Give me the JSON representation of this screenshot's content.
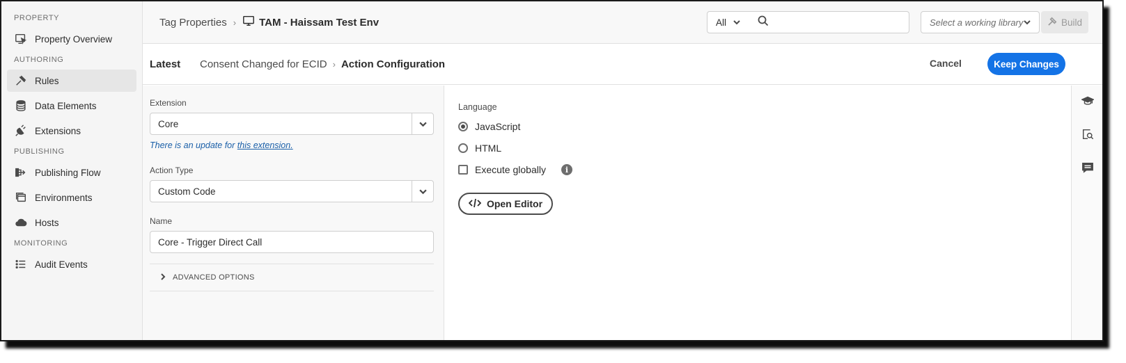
{
  "sidebar": {
    "sections": [
      {
        "title": "PROPERTY",
        "items": [
          {
            "label": "Property Overview",
            "icon": "property-overview-icon"
          }
        ]
      },
      {
        "title": "AUTHORING",
        "items": [
          {
            "label": "Rules",
            "icon": "rules-icon"
          },
          {
            "label": "Data Elements",
            "icon": "data-elements-icon"
          },
          {
            "label": "Extensions",
            "icon": "extensions-icon"
          }
        ]
      },
      {
        "title": "PUBLISHING",
        "items": [
          {
            "label": "Publishing Flow",
            "icon": "publishing-flow-icon"
          },
          {
            "label": "Environments",
            "icon": "environments-icon"
          },
          {
            "label": "Hosts",
            "icon": "hosts-icon"
          }
        ]
      },
      {
        "title": "MONITORING",
        "items": [
          {
            "label": "Audit Events",
            "icon": "audit-events-icon"
          }
        ]
      }
    ],
    "active": "Rules"
  },
  "topbar": {
    "breadcrumb_root": "Tag Properties",
    "property_name": "TAM - Haissam Test Env",
    "filter_value": "All",
    "search_placeholder": "",
    "library_placeholder": "Select a working library",
    "build_label": "Build"
  },
  "subheader": {
    "latest": "Latest",
    "parent": "Consent Changed for ECID",
    "current": "Action Configuration",
    "cancel_label": "Cancel",
    "keep_label": "Keep Changes"
  },
  "form": {
    "extension_label": "Extension",
    "extension_value": "Core",
    "update_note_prefix": "There is an update for ",
    "update_note_link": "this extension.",
    "action_type_label": "Action Type",
    "action_type_value": "Custom Code",
    "name_label": "Name",
    "name_value": "Core - Trigger Direct Call",
    "advanced_label": "ADVANCED OPTIONS"
  },
  "config": {
    "language_label": "Language",
    "options": [
      "JavaScript",
      "HTML"
    ],
    "selected": "JavaScript",
    "execute_globally_label": "Execute globally",
    "execute_globally_checked": false,
    "info_glyph": "i",
    "open_editor_label": "Open Editor"
  },
  "colors": {
    "accent": "#1473e6",
    "link": "#1a5fa8"
  }
}
